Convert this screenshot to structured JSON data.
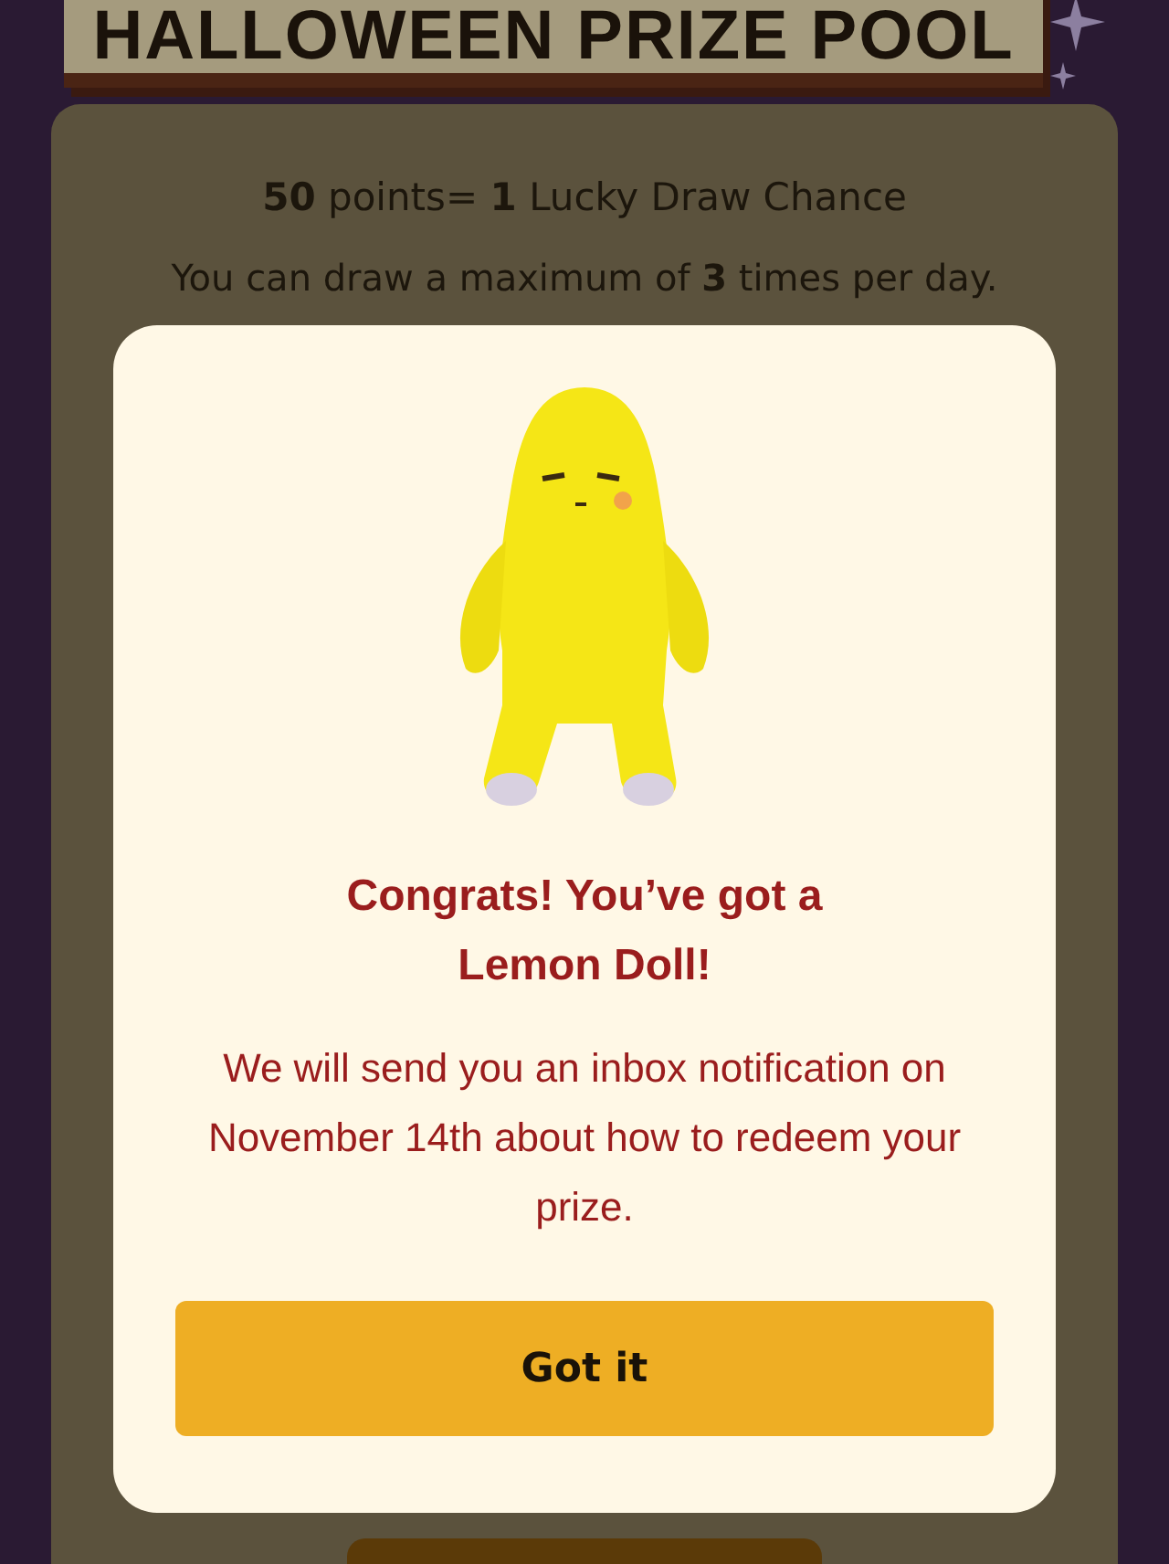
{
  "banner": {
    "title": "HALLOWEEN PRIZE POOL"
  },
  "rules": {
    "line_1": "**50** points= **1** Lucky Draw Chance",
    "line_2": "You can draw a maximum of **3** times per day."
  },
  "dialog": {
    "heading": "Congrats! You’ve got a Lemon Doll!",
    "message": "We will send you an inbox notification on November 14th about how to redeem your prize.",
    "button": "Got it"
  }
}
